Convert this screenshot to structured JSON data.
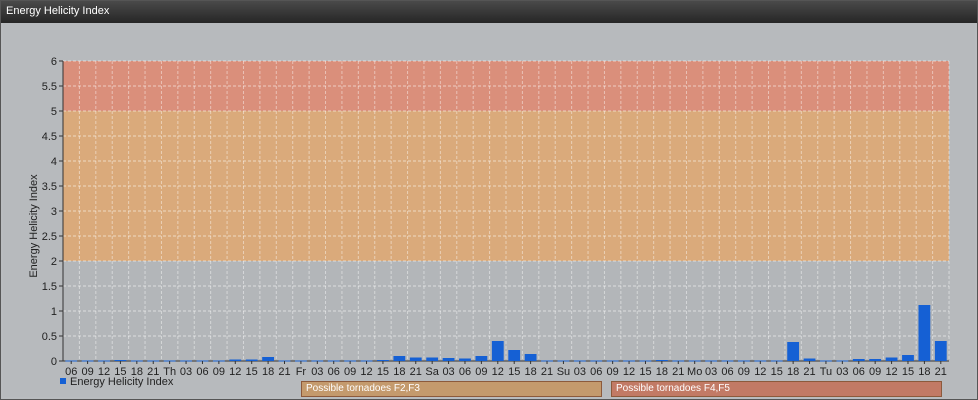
{
  "window": {
    "title": "Energy Helicity Index"
  },
  "legend": {
    "label": "Energy Helicity Index"
  },
  "zones": [
    {
      "label": "Possible tornadoes F2,F3",
      "color": "#e0a870",
      "from": 2,
      "to": 5
    },
    {
      "label": "Possible tornadoes F4,F5",
      "color": "#e08870",
      "from": 5,
      "to": 6
    }
  ],
  "chart_data": {
    "type": "bar",
    "ylabel": "Energy Helicity Index",
    "ylim": [
      0,
      6
    ],
    "yticks": [
      "0",
      "0.5",
      "1",
      "1.5",
      "2",
      "2.5",
      "3",
      "3.5",
      "4",
      "4.5",
      "5",
      "5.5",
      "6"
    ],
    "bar_color": "#1560d4",
    "grid": true,
    "categories": [
      "06",
      "09",
      "12",
      "15",
      "18",
      "21",
      "Th",
      "03",
      "06",
      "09",
      "12",
      "15",
      "18",
      "21",
      "Fr",
      "03",
      "06",
      "09",
      "12",
      "15",
      "18",
      "21",
      "Sa",
      "03",
      "06",
      "09",
      "12",
      "15",
      "18",
      "21",
      "Su",
      "03",
      "06",
      "09",
      "12",
      "15",
      "18",
      "21",
      "Mo",
      "03",
      "06",
      "09",
      "12",
      "15",
      "18",
      "21",
      "Tu",
      "03",
      "06",
      "09",
      "12",
      "15",
      "18",
      "21"
    ],
    "series": [
      {
        "name": "Energy Helicity Index",
        "values": [
          0.01,
          0.01,
          0.01,
          0.02,
          0.01,
          0.01,
          0.01,
          0.01,
          0.01,
          0.01,
          0.03,
          0.03,
          0.08,
          0.01,
          0.01,
          0.01,
          0.01,
          0.01,
          0.01,
          0.02,
          0.1,
          0.07,
          0.07,
          0.06,
          0.05,
          0.1,
          0.4,
          0.22,
          0.14,
          0.01,
          0.01,
          0.01,
          0.01,
          0.01,
          0.01,
          0.01,
          0.02,
          0.01,
          0.01,
          0.01,
          0.01,
          0.01,
          0.01,
          0.01,
          0.38,
          0.05,
          0.01,
          0.01,
          0.04,
          0.04,
          0.07,
          0.12,
          1.12,
          0.4
        ]
      }
    ]
  }
}
